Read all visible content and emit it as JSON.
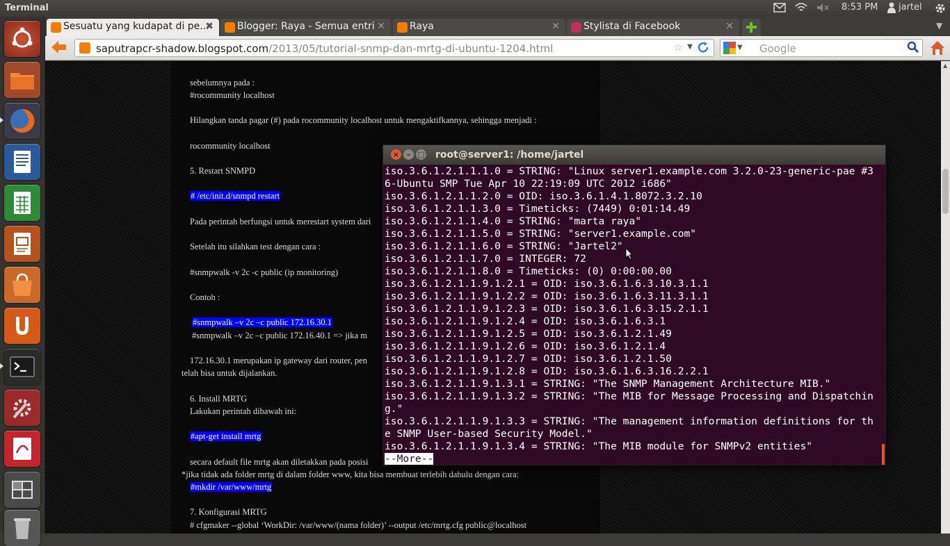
{
  "topbar": {
    "title": "Terminal",
    "time": "8:53 PM",
    "user": "jartel"
  },
  "tabs": [
    {
      "label": "Sesuatu yang kudapat di pe...",
      "close": "✖"
    },
    {
      "label": "Blogger: Raya - Semua entri",
      "close": "✕"
    },
    {
      "label": "Raya",
      "close": "✕"
    },
    {
      "label": "Stylista di Facebook",
      "close": "✕"
    }
  ],
  "url": {
    "domain": "saputrapcr-shadow.blogspot.com",
    "path": "/2013/05/tutorial-snmp-dan-mrtg-di-ubuntu-1204.html"
  },
  "search": {
    "placeholder": "Google"
  },
  "post_lines": [
    "sebelumnya pada :",
    "#rocommunity localhost",
    "Hilangkan tanda pagar (#) pada rocommunity localhost untuk mengaktifkannya, sehingga menjadi :",
    "rocommunity localhost",
    "5. Restart SNMPD",
    "# /etc/init.d/snmpd restart",
    "Pada perintah berfungsi untuk merestart system dari",
    "Setelah itu silahkan test dengan cara :",
    "#snmpwalk -v 2c -c public (ip monitoring)",
    "Contoh :",
    "#snmpwalk –v 2c –c public 172.16.30.1",
    "#snmpwalk –v 2c –c public 172.16.40.1 => jika m",
    "172.16.30.1 merupakan ip gateway dari router, pen",
    "telah bisa untuk dijalankan.",
    "6. Install MRTG",
    "Lakukan perintah dibawah ini:",
    "#apt-get install mrtg",
    "secara default file mrtg akan diletakkan pada posisi",
    "*jika tidak ada folder mrtg di dalam folder www, kita bisa membuat terlebih dahulu dengan cara:",
    "#mkdir /var/www/mrtg",
    "7. Konfigurasi MRTG",
    "# cfgmaker --global ‘WorkDir: /var/www/(nama folder)’ --output /etc/mrtg.cfg public@localhost"
  ],
  "terminal": {
    "title": "root@server1: /home/jartel",
    "lines": [
      "iso.3.6.1.2.1.1.1.0 = STRING: \"Linux server1.example.com 3.2.0-23-generic-pae #3",
      "6-Ubuntu SMP Tue Apr 10 22:19:09 UTC 2012 i686\"",
      "iso.3.6.1.2.1.1.2.0 = OID: iso.3.6.1.4.1.8072.3.2.10",
      "iso.3.6.1.2.1.1.3.0 = Timeticks: (7449) 0:01:14.49",
      "iso.3.6.1.2.1.1.4.0 = STRING: \"marta raya\"",
      "iso.3.6.1.2.1.1.5.0 = STRING: \"server1.example.com\"",
      "iso.3.6.1.2.1.1.6.0 = STRING: \"Jartel2\"",
      "iso.3.6.1.2.1.1.7.0 = INTEGER: 72",
      "iso.3.6.1.2.1.1.8.0 = Timeticks: (0) 0:00:00.00",
      "iso.3.6.1.2.1.1.9.1.2.1 = OID: iso.3.6.1.6.3.10.3.1.1",
      "iso.3.6.1.2.1.1.9.1.2.2 = OID: iso.3.6.1.6.3.11.3.1.1",
      "iso.3.6.1.2.1.1.9.1.2.3 = OID: iso.3.6.1.6.3.15.2.1.1",
      "iso.3.6.1.2.1.1.9.1.2.4 = OID: iso.3.6.1.6.3.1",
      "iso.3.6.1.2.1.1.9.1.2.5 = OID: iso.3.6.1.2.1.49",
      "iso.3.6.1.2.1.1.9.1.2.6 = OID: iso.3.6.1.2.1.4",
      "iso.3.6.1.2.1.1.9.1.2.7 = OID: iso.3.6.1.2.1.50",
      "iso.3.6.1.2.1.1.9.1.2.8 = OID: iso.3.6.1.6.3.16.2.2.1",
      "iso.3.6.1.2.1.1.9.1.3.1 = STRING: \"The SNMP Management Architecture MIB.\"",
      "iso.3.6.1.2.1.1.9.1.3.2 = STRING: \"The MIB for Message Processing and Dispatchin",
      "g.\"",
      "iso.3.6.1.2.1.1.9.1.3.3 = STRING: \"The management information definitions for th",
      "e SNMP User-based Security Model.\"",
      "iso.3.6.1.2.1.1.9.1.3.4 = STRING: \"The MIB module for SNMPv2 entities\""
    ],
    "prompt": "--More--"
  },
  "launcher": [
    "ubuntu-dash-icon",
    "files-icon",
    "firefox-icon",
    "writer-icon",
    "calc-icon",
    "impress-icon",
    "software-center-icon",
    "ubuntu-one-icon",
    "terminal-icon",
    "system-settings-icon",
    "document-viewer-icon",
    "workspace-switcher-icon",
    "trash-icon"
  ]
}
